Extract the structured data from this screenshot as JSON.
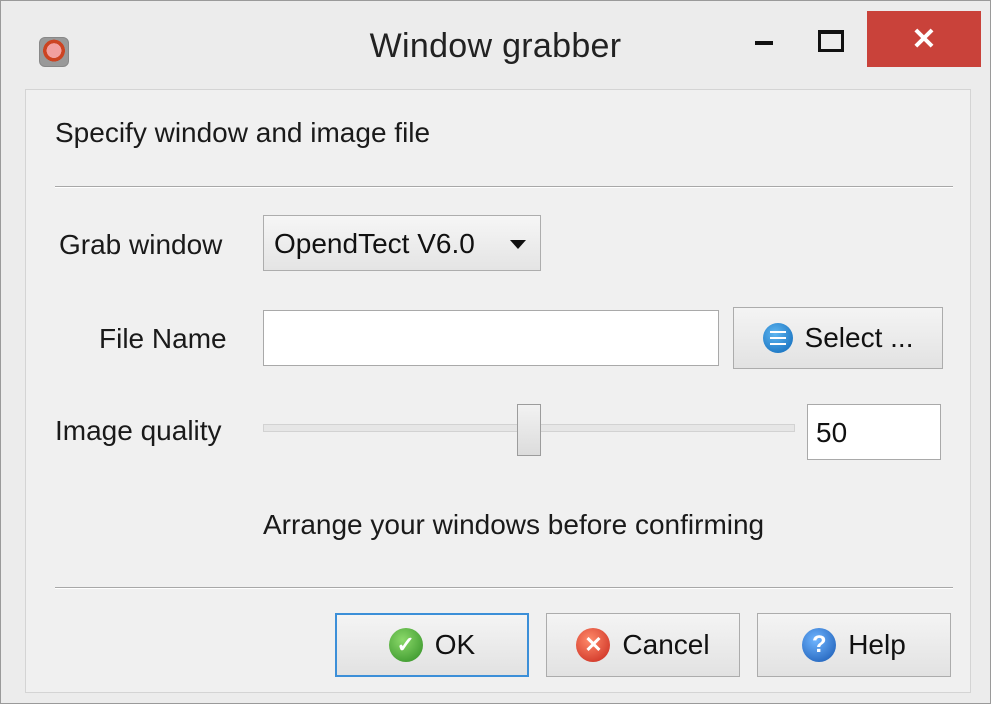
{
  "window": {
    "title": "Window grabber",
    "close_glyph": "✕",
    "icons": {
      "app": "app-icon",
      "minimize": "minimize-icon",
      "maximize": "maximize-icon",
      "close": "close-icon"
    }
  },
  "heading": "Specify window and image file",
  "grab_window": {
    "label": "Grab window",
    "value": "OpendTect V6.0"
  },
  "file_name": {
    "label": "File Name",
    "value": "",
    "select_label": "Select ...",
    "select_icon": "list-icon"
  },
  "image_quality": {
    "label": "Image quality",
    "value": "50",
    "slider_level": 0.5
  },
  "hint": "Arrange your windows before confirming",
  "buttons": {
    "ok": {
      "label": "OK",
      "icon": "ok-icon",
      "glyph": "✓"
    },
    "cancel": {
      "label": "Cancel",
      "icon": "cancel-icon",
      "glyph": "✕"
    },
    "help": {
      "label": "Help",
      "icon": "help-icon",
      "glyph": "?"
    }
  },
  "colors": {
    "close_button": "#c9423a",
    "default_button_border": "#3c8fd8",
    "background": "#f0f0f0"
  }
}
